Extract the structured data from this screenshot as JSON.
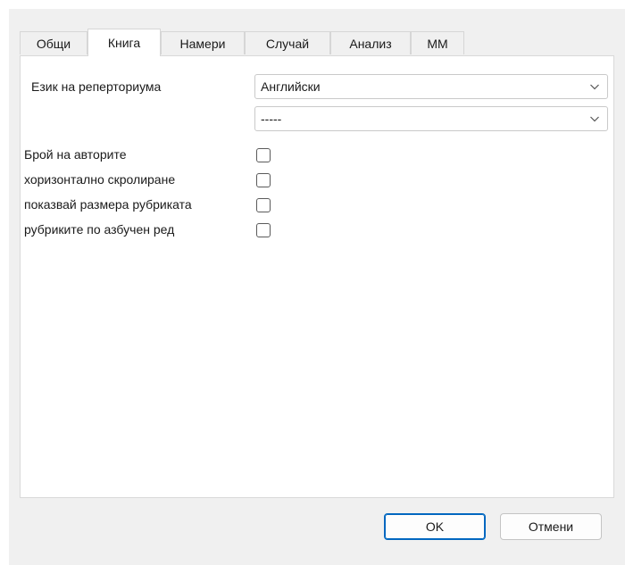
{
  "tabs": [
    {
      "label": "Общи"
    },
    {
      "label": "Книга"
    },
    {
      "label": "Намери"
    },
    {
      "label": "Случай"
    },
    {
      "label": "Анализ"
    },
    {
      "label": "ММ"
    }
  ],
  "active_tab": "Книга",
  "repertory": {
    "language_label": "Език на реперториума",
    "language_value": "Английски",
    "second_value": "-----"
  },
  "options": [
    {
      "label": "Брой на авторите",
      "checked": false
    },
    {
      "label": "хоризонтално скролиране",
      "checked": false
    },
    {
      "label": "показвай размера рубриката",
      "checked": false
    },
    {
      "label": "рубриките по азбучен ред",
      "checked": false
    }
  ],
  "buttons": {
    "ok": "OK",
    "cancel": "Отмени"
  },
  "colors": {
    "dialog_bg": "#f0f0f0",
    "panel_bg": "#ffffff",
    "accent": "#0067c0"
  }
}
